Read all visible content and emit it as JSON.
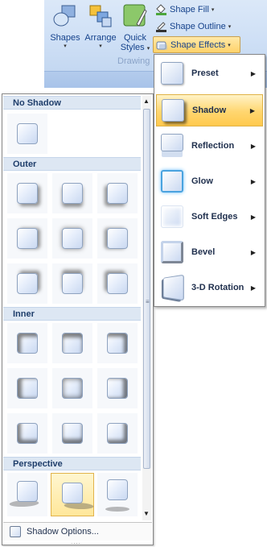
{
  "ribbon": {
    "buttons": [
      {
        "label": "Shapes",
        "icon": "shapes-icon"
      },
      {
        "label": "Arrange",
        "icon": "arrange-icon"
      },
      {
        "label": "Quick",
        "label2": "Styles",
        "icon": "quick-styles-icon"
      }
    ],
    "group_label": "Drawing",
    "shape_fill": "Shape Fill",
    "shape_outline": "Shape Outline",
    "shape_effects": "Shape Effects",
    "dropdown_arrow": "▾"
  },
  "gallery": {
    "sections": [
      {
        "title": "No Shadow"
      },
      {
        "title": "Outer"
      },
      {
        "title": "Inner"
      },
      {
        "title": "Perspective"
      }
    ],
    "footer": "Shadow Options...",
    "grip": "....",
    "scroll_up": "▲",
    "scroll_down": "▼",
    "scroll_grip": "≡"
  },
  "menu": {
    "items": [
      {
        "label": "Preset",
        "icon": "preset-icon"
      },
      {
        "label": "Shadow",
        "icon": "shadow-icon",
        "highlighted": true
      },
      {
        "label": "Reflection",
        "icon": "reflection-icon"
      },
      {
        "label": "Glow",
        "icon": "glow-icon"
      },
      {
        "label": "Soft Edges",
        "icon": "soft-edges-icon"
      },
      {
        "label": "Bevel",
        "icon": "bevel-icon"
      },
      {
        "label": "3-D Rotation",
        "icon": "3d-rotation-icon"
      }
    ],
    "submenu_arrow": "▶"
  },
  "colors": {
    "highlight": "#ffd66f",
    "ribbon": "#cfe0f6",
    "text": "#15428b"
  }
}
